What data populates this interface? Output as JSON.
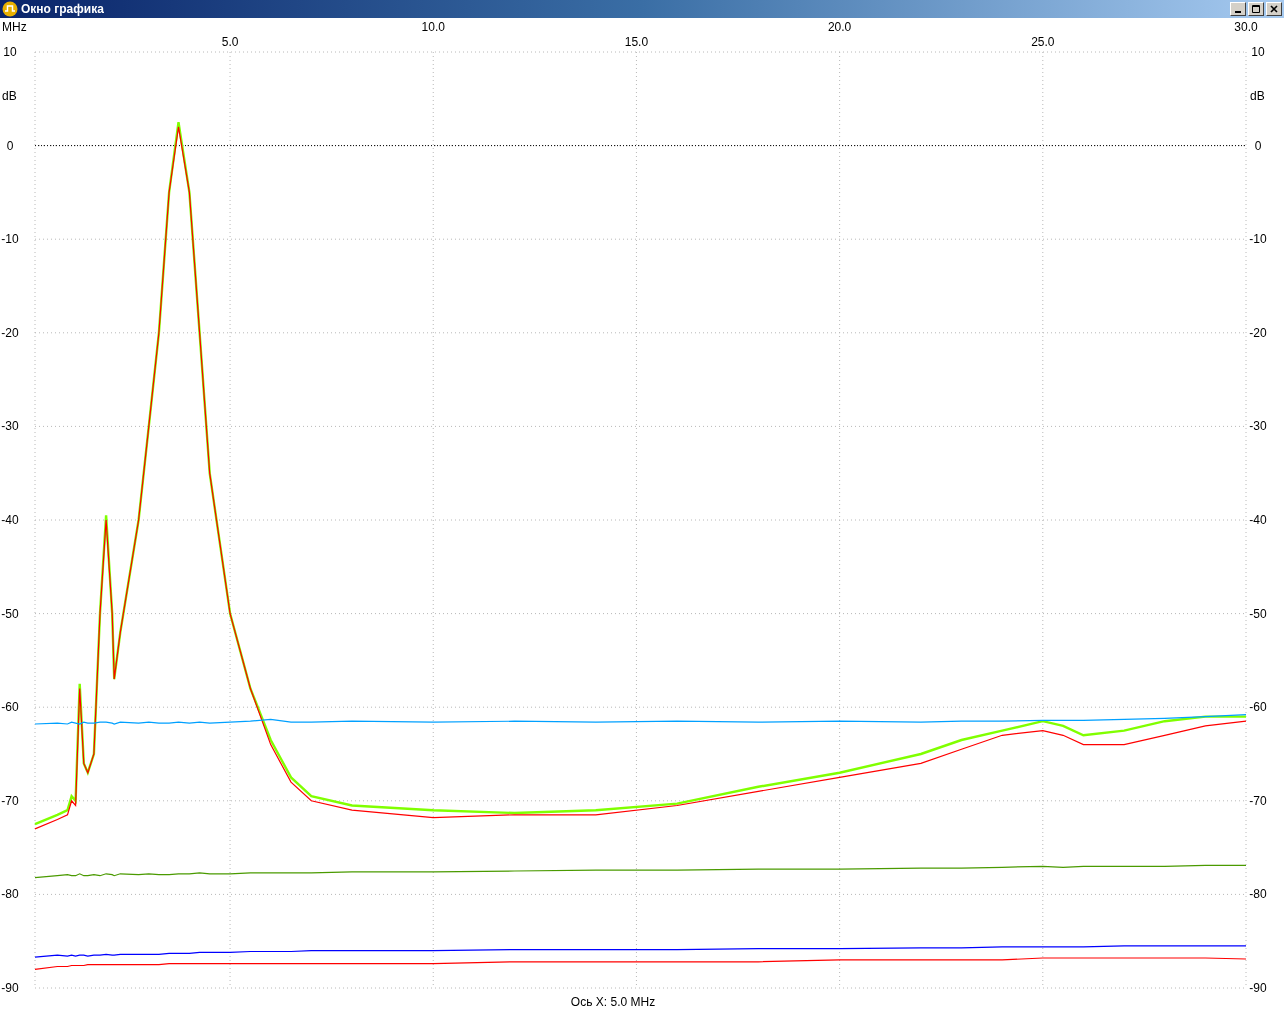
{
  "window": {
    "title": "Окно графика"
  },
  "chart": {
    "right_axis_label": "dB",
    "lower_x_labels": [
      "5.0",
      "15.0",
      "25.0"
    ],
    "left_tick_labels": [
      "10",
      "0",
      "-10",
      "-20",
      "-30",
      "-40",
      "-50",
      "-60",
      "-70",
      "-80",
      "-90"
    ],
    "chart_data": {
      "type": "line",
      "grid": true,
      "ref_lines": [
        {
          "axis": "y",
          "value": 0,
          "color": "#000000"
        }
      ],
      "xlabel": "MHz",
      "ylabel": "dB",
      "xlim": [
        0.2,
        30
      ],
      "ylim": [
        -90,
        10
      ],
      "xticks": [
        {
          "value": 10,
          "label": "10.0"
        },
        {
          "value": 20,
          "label": "20.0"
        },
        {
          "value": 30,
          "label": "30.0"
        }
      ],
      "yticks": [
        10,
        0,
        -10,
        -20,
        -30,
        -40,
        -50,
        -60,
        -70,
        -80,
        -90
      ],
      "x": [
        0.2,
        0.75,
        1.0,
        1.1,
        1.2,
        1.3,
        1.4,
        1.5,
        1.65,
        1.8,
        1.95,
        2.1,
        2.15,
        2.3,
        2.75,
        3.0,
        3.25,
        3.5,
        3.73,
        4.0,
        4.25,
        4.5,
        5.0,
        5.5,
        6.0,
        6.5,
        7.0,
        8.0,
        10,
        12,
        14,
        16,
        18,
        20,
        22,
        23,
        24,
        25,
        25.5,
        26,
        27,
        28,
        29,
        30
      ],
      "series": [
        {
          "color": "#80ff00",
          "values": [
            -72.5,
            -71.5,
            -71,
            -69.5,
            -70,
            -57.5,
            -66,
            -67,
            -65,
            -50,
            -39.5,
            -50,
            -57,
            -52,
            -40,
            -30,
            -20,
            -5,
            2.5,
            -5,
            -20,
            -35,
            -50,
            -58,
            -63.5,
            -67.5,
            -69.5,
            -70.5,
            -71,
            -71.3,
            -71,
            -70.3,
            -68.5,
            -67,
            -65,
            -63.5,
            -62.5,
            -61.5,
            -62,
            -63,
            -62.5,
            -61.5,
            -61,
            -61
          ]
        },
        {
          "color": "#ff0000",
          "values": [
            -73,
            -72,
            -71.5,
            -70,
            -70.5,
            -58,
            -66,
            -67,
            -65,
            -50,
            -40,
            -50,
            -57,
            -52,
            -40,
            -30,
            -20,
            -5,
            2,
            -5,
            -20,
            -35,
            -50,
            -58,
            -64,
            -68,
            -70,
            -71,
            -71.8,
            -71.5,
            -71.5,
            -70.5,
            -69,
            -67.5,
            -66,
            -64.5,
            -63,
            -62.5,
            -63,
            -64,
            -64,
            -63,
            -62,
            -61.5
          ]
        },
        {
          "color": "#00a0ff",
          "values": [
            -61.8,
            -61.7,
            -61.8,
            -61.6,
            -61.7,
            -61.8,
            -61.6,
            -61.7,
            -61.7,
            -61.6,
            -61.6,
            -61.7,
            -61.8,
            -61.6,
            -61.7,
            -61.6,
            -61.7,
            -61.7,
            -61.6,
            -61.7,
            -61.6,
            -61.7,
            -61.6,
            -61.5,
            -61.3,
            -61.6,
            -61.6,
            -61.5,
            -61.6,
            -61.5,
            -61.6,
            -61.5,
            -61.6,
            -61.5,
            -61.6,
            -61.5,
            -61.5,
            -61.4,
            -61.4,
            -61.4,
            -61.3,
            -61.2,
            -61,
            -60.8
          ]
        },
        {
          "color": "#4a9a00",
          "values": [
            -78.2,
            -78,
            -77.9,
            -78,
            -78,
            -77.8,
            -78,
            -78,
            -77.9,
            -78,
            -77.8,
            -77.9,
            -78,
            -77.8,
            -77.9,
            -77.8,
            -77.9,
            -77.9,
            -77.8,
            -77.8,
            -77.7,
            -77.8,
            -77.8,
            -77.7,
            -77.7,
            -77.7,
            -77.7,
            -77.6,
            -77.6,
            -77.5,
            -77.4,
            -77.4,
            -77.3,
            -77.3,
            -77.2,
            -77.2,
            -77.1,
            -77,
            -77.1,
            -77,
            -77,
            -77,
            -76.9,
            -76.9
          ]
        },
        {
          "color": "#0000ff",
          "values": [
            -86.7,
            -86.5,
            -86.6,
            -86.5,
            -86.6,
            -86.5,
            -86.5,
            -86.6,
            -86.5,
            -86.5,
            -86.4,
            -86.5,
            -86.5,
            -86.4,
            -86.4,
            -86.4,
            -86.4,
            -86.3,
            -86.3,
            -86.3,
            -86.2,
            -86.2,
            -86.2,
            -86.1,
            -86.1,
            -86.1,
            -86,
            -86,
            -86,
            -85.9,
            -85.9,
            -85.9,
            -85.8,
            -85.8,
            -85.7,
            -85.7,
            -85.6,
            -85.6,
            -85.6,
            -85.6,
            -85.5,
            -85.5,
            -85.5,
            -85.5
          ]
        },
        {
          "color": "#ff0000",
          "values": [
            -88,
            -87.7,
            -87.7,
            -87.6,
            -87.6,
            -87.6,
            -87.6,
            -87.5,
            -87.5,
            -87.5,
            -87.5,
            -87.5,
            -87.5,
            -87.5,
            -87.5,
            -87.5,
            -87.5,
            -87.4,
            -87.4,
            -87.4,
            -87.4,
            -87.4,
            -87.4,
            -87.4,
            -87.4,
            -87.4,
            -87.4,
            -87.4,
            -87.4,
            -87.2,
            -87.2,
            -87.2,
            -87.2,
            -87,
            -87,
            -87,
            -87,
            -86.8,
            -86.8,
            -86.8,
            -86.8,
            -86.8,
            -86.8,
            -86.9
          ]
        }
      ]
    }
  },
  "status": "Ось X: 5.0 MHz"
}
